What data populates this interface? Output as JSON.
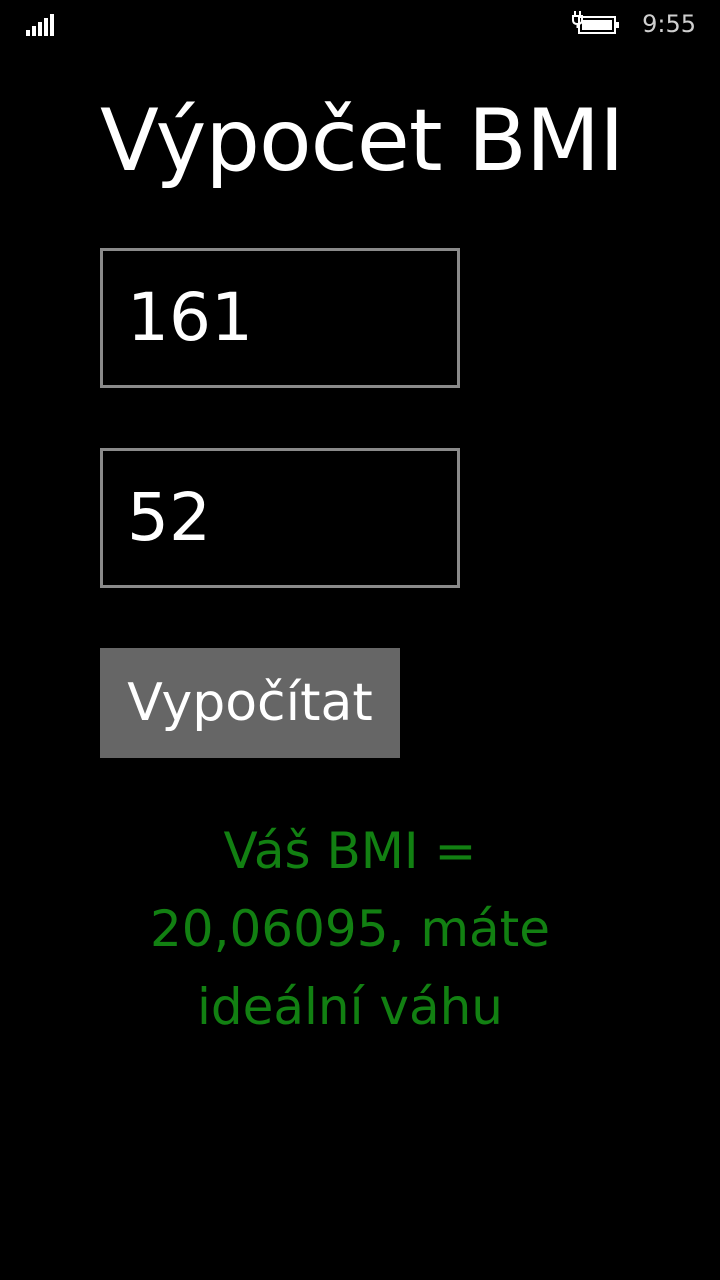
{
  "status_bar": {
    "time": "9:55",
    "signal_icon": "signal-bars-icon",
    "battery_icon": "battery-charging-icon"
  },
  "page": {
    "title": "Výpočet BMI"
  },
  "form": {
    "height_value": "161",
    "weight_value": "52",
    "calculate_label": "Vypočítat"
  },
  "result": {
    "text": "Váš BMI = 20,06095, máte ideální váhu",
    "color": "#128012"
  },
  "colors": {
    "background": "#000000",
    "text": "#ffffff",
    "input_border": "#8a8a8a",
    "button_bg": "#666666"
  }
}
